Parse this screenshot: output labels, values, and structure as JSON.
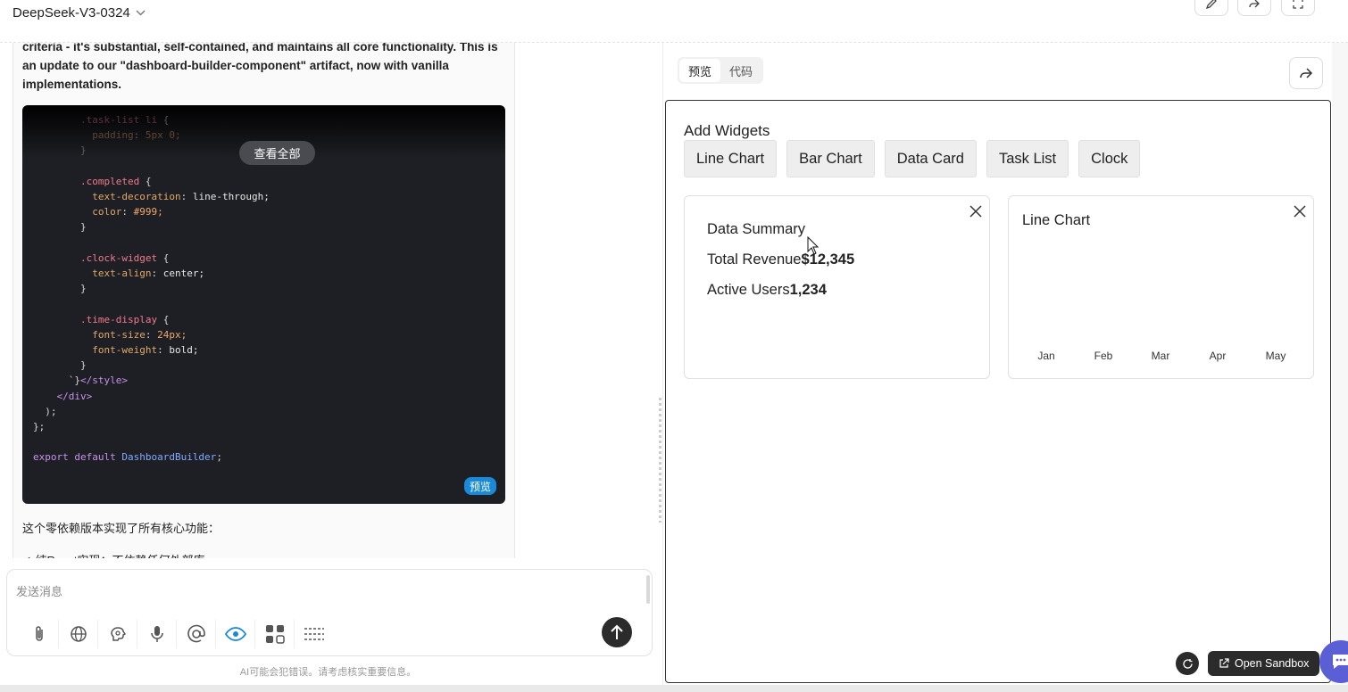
{
  "header": {
    "model_name": "DeepSeek-V3-0324"
  },
  "message": {
    "text_partial": "criteria - it's substantial, self-contained, and maintains all core functionality. This is an update to our \"dashboard-builder-component\" artifact, now with vanilla implementations.",
    "view_all_label": "查看全部",
    "preview_label": "预览",
    "after_code_text": "这个零依赖版本实现了所有核心功能：",
    "partial_bullet": "✓ 纯React实现：不依赖任何外部库"
  },
  "code": {
    "lines": [
      "        .task-list li {",
      "          padding: 5px 0;",
      "        }",
      "",
      "        .completed {",
      "          text-decoration: line-through;",
      "          color: #999;",
      "        }",
      "",
      "        .clock-widget {",
      "          text-align: center;",
      "        }",
      "",
      "        .time-display {",
      "          font-size: 24px;",
      "          font-weight: bold;",
      "        }",
      "      `}</style>",
      "    </div>",
      "  );",
      "};",
      "",
      "export default DashboardBuilder;"
    ]
  },
  "composer": {
    "placeholder": "发送消息",
    "disclaimer": "AI可能会犯错误。请考虑核实重要信息。",
    "tools": [
      "paperclip-icon",
      "globe-icon",
      "brain-icon",
      "microphone-icon",
      "at-icon",
      "eye-icon",
      "apps-icon",
      "divider-lines-icon"
    ]
  },
  "panel": {
    "tabs": [
      "预览",
      "代码"
    ],
    "active_tab": "预览",
    "add_widgets_title": "Add Widgets",
    "widget_buttons": [
      "Line Chart",
      "Bar Chart",
      "Data Card",
      "Task List",
      "Clock"
    ],
    "data_card": {
      "title": "Data Summary",
      "revenue_label": "Total Revenue",
      "revenue_value": "$12,345",
      "users_label": "Active Users",
      "users_value": "1,234"
    },
    "line_chart": {
      "title": "Line Chart",
      "months": [
        "Jan",
        "Feb",
        "Mar",
        "Apr",
        "May"
      ]
    },
    "open_sandbox_label": "Open Sandbox"
  },
  "colors": {
    "accent_blue": "#1a8ad8",
    "dark_button": "#2b2b2b",
    "fab_purple": "#5b5fd6"
  }
}
